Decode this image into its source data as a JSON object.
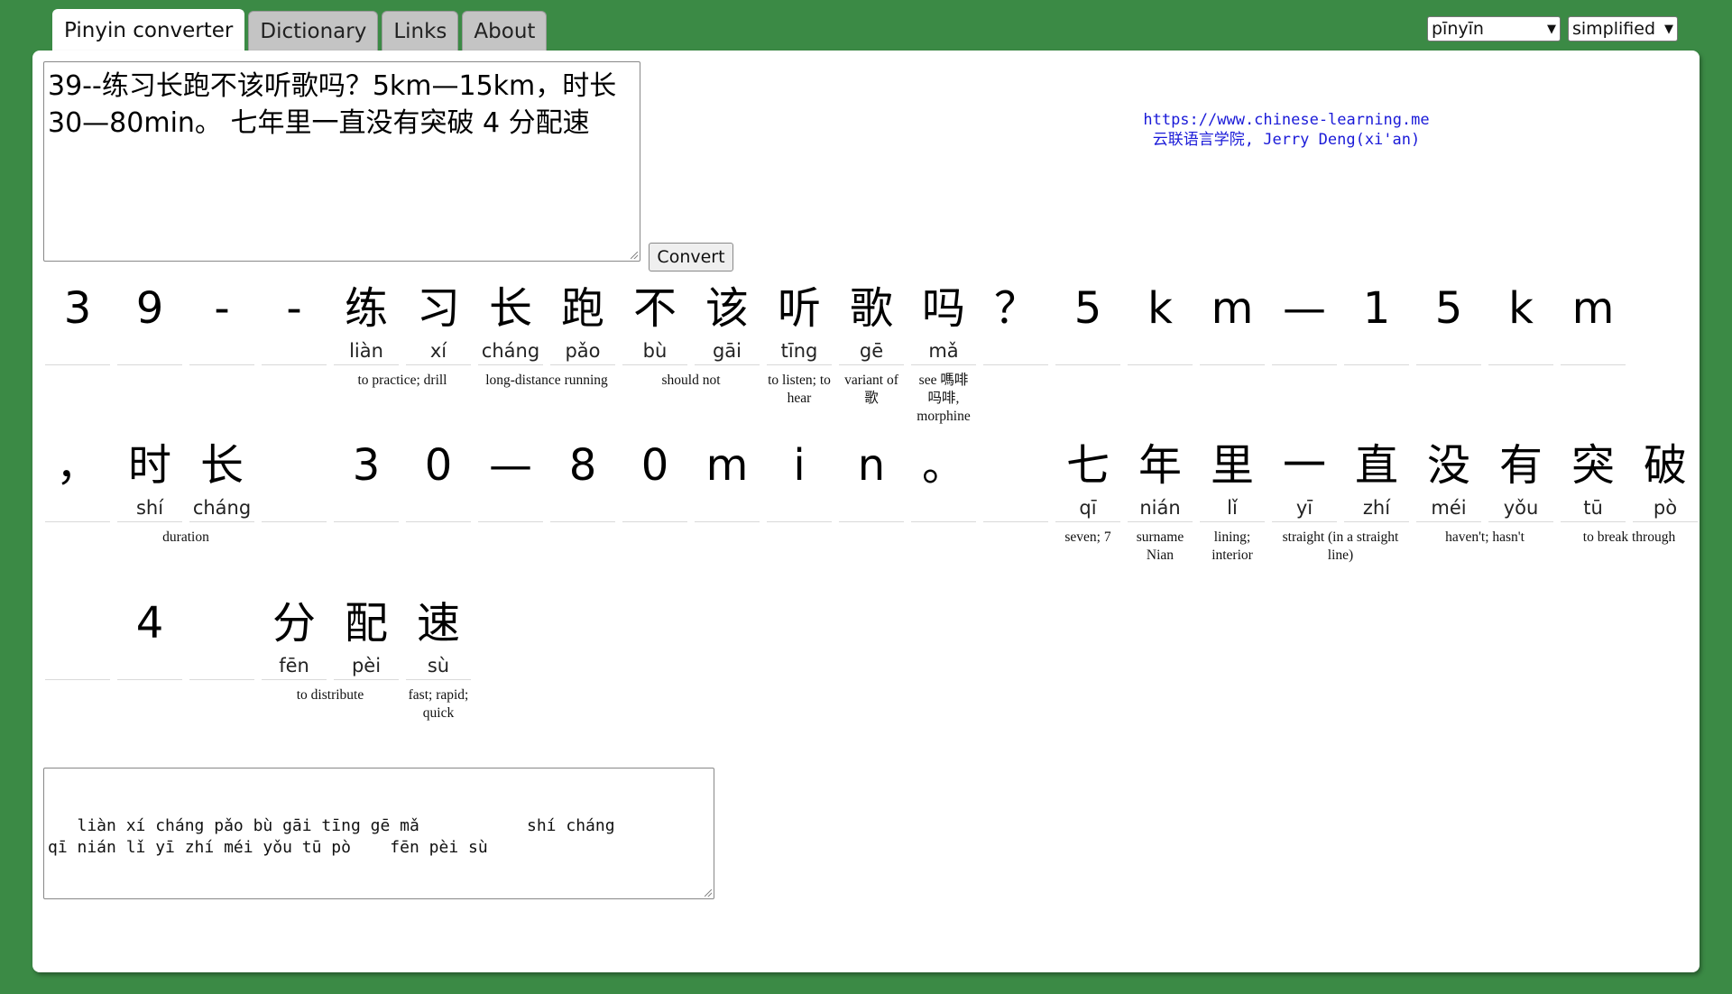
{
  "tabs": [
    {
      "label": "Pinyin converter",
      "active": true
    },
    {
      "label": "Dictionary",
      "active": false
    },
    {
      "label": "Links",
      "active": false
    },
    {
      "label": "About",
      "active": false
    }
  ],
  "selects": {
    "mode": "pīnyīn",
    "script": "simplified"
  },
  "input_text": "39--练习长跑不该听歌吗？5km—15km，时长\n30—80min。 七年里一直没有突破 4 分配速",
  "convert_label": "Convert",
  "credit": {
    "url": "https://www.chinese-learning.me",
    "author": "云联语言学院, Jerry Deng(xi'an)"
  },
  "rows": [
    {
      "cells": [
        {
          "ch": "3",
          "py": ""
        },
        {
          "ch": "9",
          "py": ""
        },
        {
          "ch": "-",
          "py": ""
        },
        {
          "ch": "-",
          "py": ""
        },
        {
          "ch": "练",
          "py": "liàn"
        },
        {
          "ch": "习",
          "py": "xí"
        },
        {
          "ch": "长",
          "py": "cháng"
        },
        {
          "ch": "跑",
          "py": "pǎo"
        },
        {
          "ch": "不",
          "py": "bù"
        },
        {
          "ch": "该",
          "py": "gāi"
        },
        {
          "ch": "听",
          "py": "tīng"
        },
        {
          "ch": "歌",
          "py": "gē"
        },
        {
          "ch": "吗",
          "py": "mǎ"
        },
        {
          "ch": "？",
          "py": ""
        },
        {
          "ch": "5",
          "py": ""
        },
        {
          "ch": "k",
          "py": ""
        },
        {
          "ch": "m",
          "py": ""
        },
        {
          "ch": "—",
          "py": ""
        },
        {
          "ch": "1",
          "py": ""
        },
        {
          "ch": "5",
          "py": ""
        },
        {
          "ch": "k",
          "py": ""
        },
        {
          "ch": "m",
          "py": ""
        }
      ],
      "glosses": [
        {
          "start": 4,
          "span": 2,
          "text": "to practice; drill"
        },
        {
          "start": 6,
          "span": 2,
          "text": "long-distance running"
        },
        {
          "start": 8,
          "span": 2,
          "text": "should not"
        },
        {
          "start": 10,
          "span": 1,
          "text": "to listen; to hear"
        },
        {
          "start": 11,
          "span": 1,
          "text": "variant of 歌"
        },
        {
          "start": 12,
          "span": 1,
          "text": "see 嗎啡 吗啡, morphine"
        }
      ]
    },
    {
      "cells": [
        {
          "ch": "，",
          "py": ""
        },
        {
          "ch": "时",
          "py": "shí"
        },
        {
          "ch": "长",
          "py": "cháng"
        },
        {
          "ch": "",
          "py": ""
        },
        {
          "ch": "3",
          "py": ""
        },
        {
          "ch": "0",
          "py": ""
        },
        {
          "ch": "—",
          "py": ""
        },
        {
          "ch": "8",
          "py": ""
        },
        {
          "ch": "0",
          "py": ""
        },
        {
          "ch": "m",
          "py": ""
        },
        {
          "ch": "i",
          "py": ""
        },
        {
          "ch": "n",
          "py": ""
        },
        {
          "ch": "。",
          "py": ""
        },
        {
          "ch": "",
          "py": ""
        },
        {
          "ch": "七",
          "py": "qī"
        },
        {
          "ch": "年",
          "py": "nián"
        },
        {
          "ch": "里",
          "py": "lǐ"
        },
        {
          "ch": "一",
          "py": "yī"
        },
        {
          "ch": "直",
          "py": "zhí"
        },
        {
          "ch": "没",
          "py": "méi"
        },
        {
          "ch": "有",
          "py": "yǒu"
        },
        {
          "ch": "突",
          "py": "tū"
        },
        {
          "ch": "破",
          "py": "pò"
        }
      ],
      "glosses": [
        {
          "start": 1,
          "span": 2,
          "text": "duration"
        },
        {
          "start": 14,
          "span": 1,
          "text": "seven; 7"
        },
        {
          "start": 15,
          "span": 1,
          "text": "surname Nian"
        },
        {
          "start": 16,
          "span": 1,
          "text": "lining; interior"
        },
        {
          "start": 17,
          "span": 2,
          "text": "straight (in a straight line)"
        },
        {
          "start": 19,
          "span": 2,
          "text": "haven't; hasn't"
        },
        {
          "start": 21,
          "span": 2,
          "text": "to break through"
        }
      ]
    },
    {
      "cells": [
        {
          "ch": "",
          "py": ""
        },
        {
          "ch": "4",
          "py": ""
        },
        {
          "ch": "",
          "py": ""
        },
        {
          "ch": "分",
          "py": "fēn"
        },
        {
          "ch": "配",
          "py": "pèi"
        },
        {
          "ch": "速",
          "py": "sù"
        }
      ],
      "glosses": [
        {
          "start": 3,
          "span": 2,
          "text": "to distribute"
        },
        {
          "start": 5,
          "span": 1,
          "text": "fast; rapid; quick"
        }
      ]
    }
  ],
  "output_text": "   liàn xí cháng pǎo bù gāi tīng gē mǎ           shí cháng\nqī nián lǐ yī zhí méi yǒu tū pò    fēn pèi sù"
}
